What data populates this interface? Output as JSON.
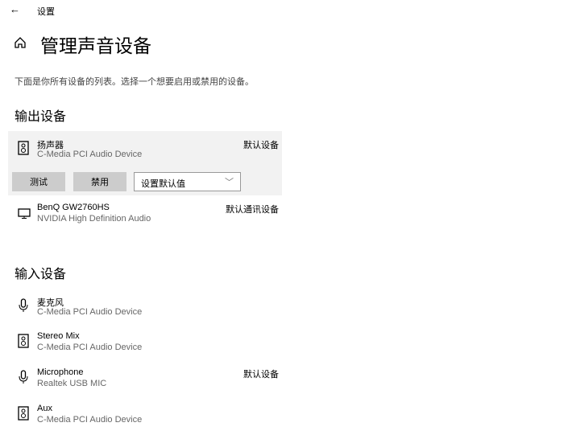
{
  "header": {
    "back_icon": "arrow-left-icon",
    "app_title": "设置"
  },
  "page": {
    "title": "管理声音设备",
    "description": "下面是你所有设备的列表。选择一个想要启用或禁用的设备。"
  },
  "output": {
    "heading": "输出设备",
    "devices": [
      {
        "name": "扬声器",
        "subtitle": "C-Media PCI Audio Device",
        "status": "默认设备",
        "icon": "speaker-icon",
        "selected": true
      },
      {
        "name": "BenQ GW2760HS",
        "subtitle": "NVIDIA High Definition Audio",
        "status": "默认通讯设备",
        "icon": "monitor-icon"
      }
    ],
    "actions": {
      "test": "测试",
      "disable": "禁用",
      "set_default": "设置默认值"
    }
  },
  "input": {
    "heading": "输入设备",
    "devices": [
      {
        "name": "麦克风",
        "subtitle": "C-Media PCI Audio Device",
        "status": "",
        "icon": "microphone-icon"
      },
      {
        "name": "Stereo Mix",
        "subtitle": "C-Media PCI Audio Device",
        "status": "",
        "icon": "speaker-icon"
      },
      {
        "name": "Microphone",
        "subtitle": "Realtek USB MIC",
        "status": "默认设备",
        "icon": "microphone-icon"
      },
      {
        "name": "Aux",
        "subtitle": "C-Media PCI Audio Device",
        "status": "",
        "icon": "speaker-icon"
      }
    ]
  }
}
